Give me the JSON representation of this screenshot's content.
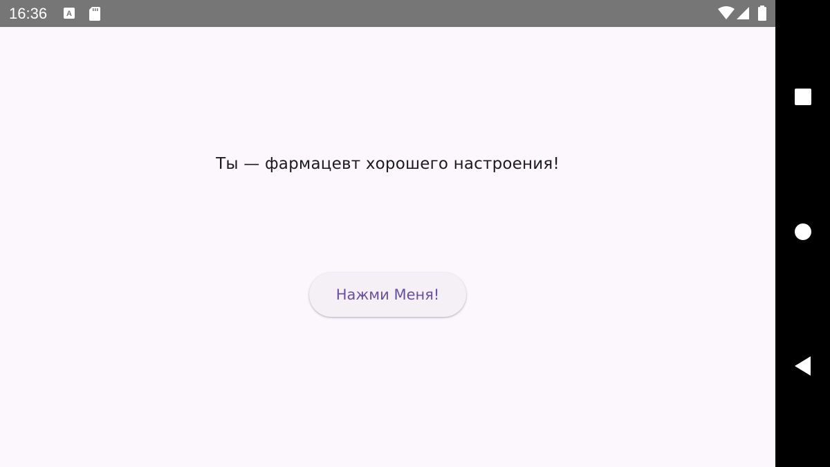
{
  "status_bar": {
    "time": "16:36",
    "icons": [
      "keyboard-a-icon",
      "sd-card-icon",
      "wifi-icon",
      "cell-signal-icon",
      "battery-icon"
    ],
    "background": "#767676"
  },
  "main": {
    "message": "Ты — фармацевт хорошего настроения!",
    "button_label": "Нажми Меня!",
    "background": "#fcf6fd",
    "accent": "#6750a4"
  },
  "nav_bar": {
    "buttons": [
      "recents-square-icon",
      "home-circle-icon",
      "back-triangle-icon"
    ],
    "background": "#000000"
  }
}
